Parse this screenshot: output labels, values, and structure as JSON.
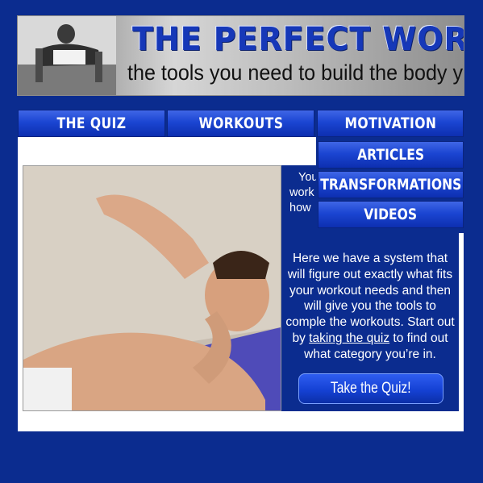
{
  "header": {
    "title": "THE PERFECT WORKOUT",
    "tagline": "the tools you need to build the body you want",
    "photo_icon": "man-pushup-photo"
  },
  "nav": {
    "items": [
      {
        "label": "THE QUIZ"
      },
      {
        "label": "WORKOUTS"
      },
      {
        "label": "MOTIVATION"
      }
    ],
    "dropdown": {
      "parent": "MOTIVATION",
      "items": [
        {
          "label": "ARTICLES"
        },
        {
          "label": "TRANSFORMATIONS"
        },
        {
          "label": "VIDEOS"
        }
      ]
    }
  },
  "main": {
    "photo_icon": "man-doing-crunches-photo",
    "intro_visible": [
      "You",
      "work",
      "how"
    ],
    "body": {
      "before_link": "Here  we have a system that will figure out exactly what fits your workout needs and then will give you the tools to comple the workouts. Start out by ",
      "link": "taking the quiz",
      "after_link": " to find out what category you’re in."
    },
    "cta_label": "Take the Quiz!"
  },
  "colors": {
    "page_background": "#0b2c8f",
    "nav_blue": "#1b45d2",
    "title_blue": "#1638b8",
    "panel": "#ffffff"
  }
}
